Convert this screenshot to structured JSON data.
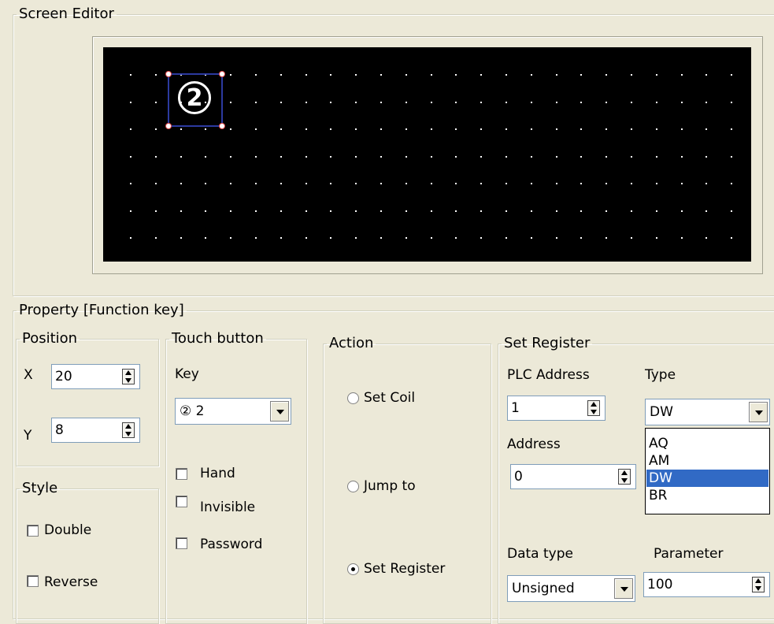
{
  "screen_editor": {
    "title": "Screen Editor",
    "canvas_item": {
      "glyph": "2"
    }
  },
  "property": {
    "title": "Property  [Function key]",
    "position": {
      "title": "Position",
      "x_label": "X",
      "x_value": "20",
      "y_label": "Y",
      "y_value": "8"
    },
    "style": {
      "title": "Style",
      "double_label": "Double",
      "reverse_label": "Reverse"
    },
    "touch_button": {
      "title": "Touch button",
      "key_label": "Key",
      "key_value": "② 2",
      "hand_label": "Hand",
      "invisible_label": "Invisible",
      "password_label": "Password"
    },
    "action": {
      "title": "Action",
      "set_coil_label": "Set Coil",
      "jump_to_label": "Jump to",
      "set_register_label": "Set Register",
      "selected": "Set Register"
    },
    "set_register": {
      "title": "Set Register",
      "plc_address_label": "PLC Address",
      "plc_address_value": "1",
      "type_label": "Type",
      "type_value": "DW",
      "type_options": [
        "AQ",
        "AM",
        "DW",
        "BR"
      ],
      "address_label": "Address",
      "address_value": "0",
      "data_type_label": "Data type",
      "data_type_value": "Unsigned",
      "parameter_label": "Parameter",
      "parameter_value": "100"
    }
  }
}
